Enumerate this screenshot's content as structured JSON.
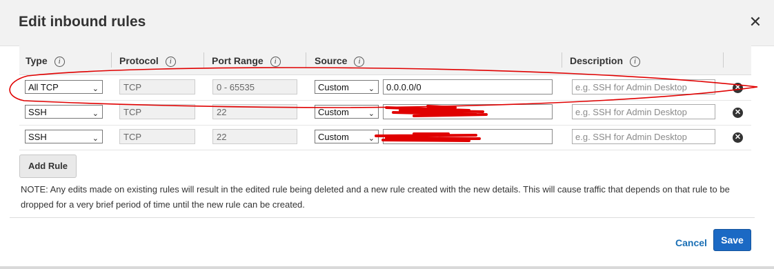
{
  "dialog": {
    "title": "Edit inbound rules",
    "close_symbol": "✕"
  },
  "table": {
    "headers": {
      "type": "Type",
      "protocol": "Protocol",
      "port_range": "Port Range",
      "source": "Source",
      "description": "Description"
    },
    "info_glyph": "i",
    "rows": [
      {
        "type": "All TCP",
        "protocol": "TCP",
        "port_range": "0 - 65535",
        "source_type": "Custom",
        "source_value": "0.0.0.0/0",
        "description_placeholder": "e.g. SSH for Admin Desktop"
      },
      {
        "type": "SSH",
        "protocol": "TCP",
        "port_range": "22",
        "source_type": "Custom",
        "source_value": "",
        "description_placeholder": "e.g. SSH for Admin Desktop"
      },
      {
        "type": "SSH",
        "protocol": "TCP",
        "port_range": "22",
        "source_type": "Custom",
        "source_value": "",
        "description_placeholder": "e.g. SSH for Admin Desktop"
      }
    ]
  },
  "buttons": {
    "add_rule": "Add Rule",
    "cancel": "Cancel",
    "save": "Save"
  },
  "note": "NOTE: Any edits made on existing rules will result in the edited rule being deleted and a new rule created with the new details. This will cause traffic that depends on that rule to be dropped for a very brief period of time until the new rule can be created.",
  "icons": {
    "close": "close-icon",
    "info": "info-icon",
    "remove": "remove-rule-icon",
    "chevron": "chevron-down-icon"
  },
  "colors": {
    "header_bg": "#f2f2f2",
    "primary": "#1b69c4",
    "link": "#1a6fb5",
    "annotation": "#e00000"
  }
}
